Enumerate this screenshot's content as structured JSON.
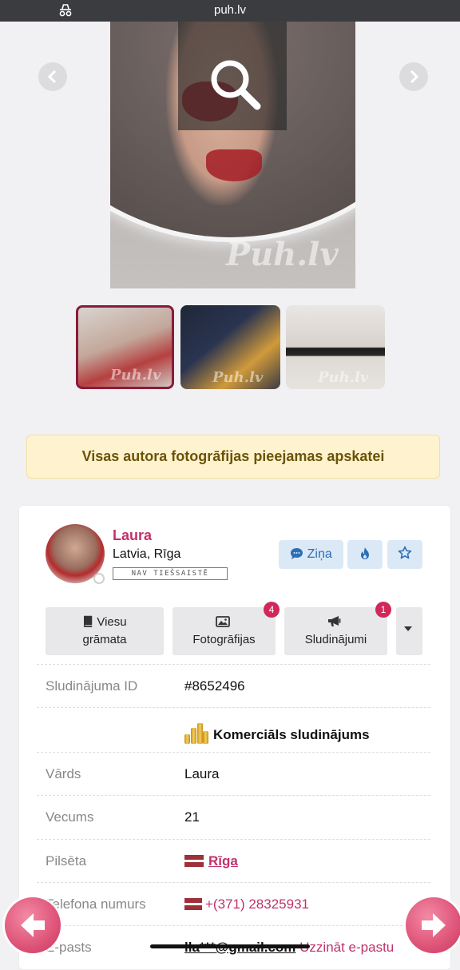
{
  "browser": {
    "domain": "puh.lv"
  },
  "gallery": {
    "watermark": "Puh.lv",
    "thumb_count": 3
  },
  "notice": {
    "text": "Visas autora fotogrāfijas pieejamas apskatei"
  },
  "profile": {
    "name": "Laura",
    "location": "Latvia, Rīga",
    "status": "NAV TIEŠSAISTĒ",
    "message_button": "Ziņa"
  },
  "tabs": {
    "guestbook": "Viesu\ngrāmata",
    "guestbook_line1": "Viesu",
    "guestbook_line2": "grāmata",
    "photos": "Fotogrāfijas",
    "photos_badge": "4",
    "ads": "Sludinājumi",
    "ads_badge": "1"
  },
  "details": {
    "ad_id_label": "Sludinājuma ID",
    "ad_id_value": "#8652496",
    "commercial": "Komerciāls sludinājums",
    "name_label": "Vārds",
    "name_value": "Laura",
    "age_label": "Vecums",
    "age_value": "21",
    "city_label": "Pilsēta",
    "city_value": "Rīga",
    "phone_label": "Telefona numurs",
    "phone_value": "+(371) 28325931",
    "email_label": "E-pasts",
    "email_value": "lla***@gmail.com",
    "email_link": "Uzzināt e-pastu"
  },
  "colors": {
    "accent": "#c0326a",
    "notice_bg": "#fff3cf",
    "button_blue": "#2c6fb5"
  }
}
